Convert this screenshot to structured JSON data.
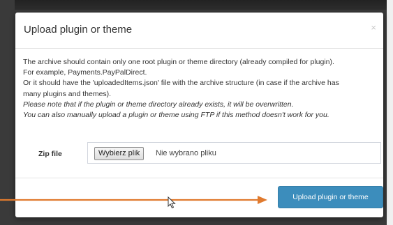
{
  "dialog": {
    "title": "Upload plugin or theme",
    "close_symbol": "×"
  },
  "description": [
    "The archive should contain only one root plugin or theme directory (already compiled for plugin).",
    "For example, Payments.PayPalDirect.",
    "Or it should have the 'uploadedItems.json' file with the archive structure (in case if the archive has",
    "many plugins and themes).",
    "Please note that if the plugin or theme directory already exists, it will be overwritten.",
    "You can also manually upload a plugin or theme using FTP if this method doesn't work for you."
  ],
  "zip_field": {
    "label": "Zip file",
    "button_label": "Wybierz plik",
    "status": "Nie wybrano pliku"
  },
  "footer": {
    "upload_label": "Upload plugin or theme"
  },
  "colors": {
    "primary_button": "#3c8dbc",
    "annotation_arrow": "#e07a2e"
  },
  "icons": [
    "close-icon",
    "arrow-annotation-icon",
    "mouse-cursor-icon"
  ]
}
